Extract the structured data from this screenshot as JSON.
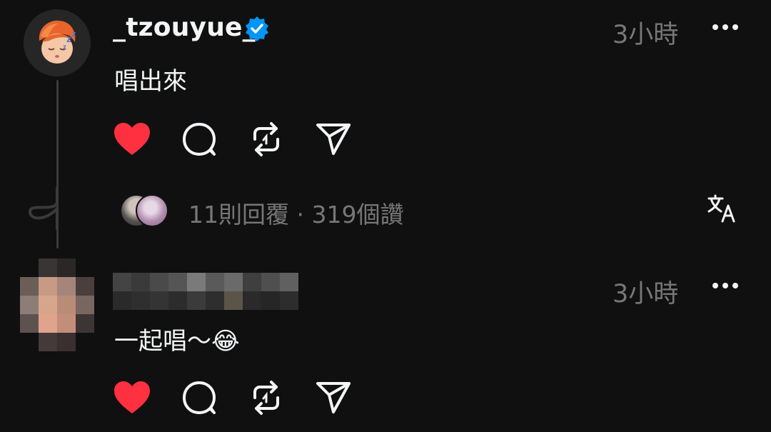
{
  "post1": {
    "username": "_tzouyue_",
    "time": "3小時",
    "text": "唱出來",
    "replies_summary": "11則回覆 · 319個讚"
  },
  "post2": {
    "time": "3小時",
    "text": "一起唱～😂"
  },
  "colors": {
    "background": "#101010",
    "heart": "#ff3040",
    "verified": "#0095f6",
    "muted_text": "#777777",
    "primary_text": "#f3f5f7"
  },
  "icons": {
    "like": "heart-icon",
    "comment": "comment-icon",
    "repost": "repost-icon",
    "share": "share-icon",
    "more": "more-icon",
    "translate": "translate-icon",
    "verified": "verified-badge-icon"
  }
}
